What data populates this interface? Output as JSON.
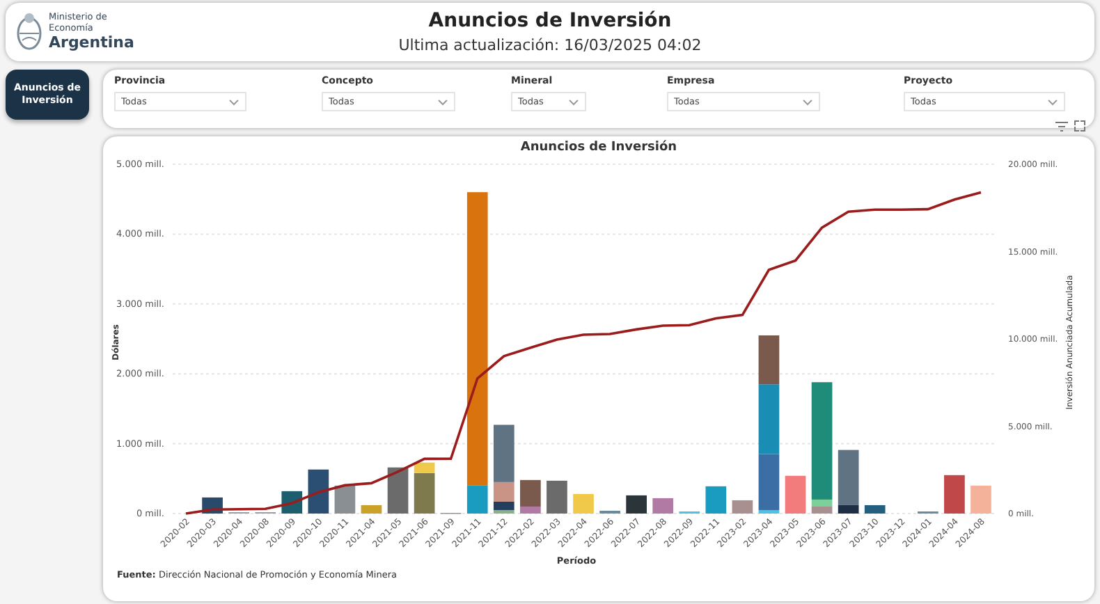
{
  "header": {
    "logo_small": "Ministerio de Economía",
    "logo_big": "Argentina",
    "title": "Anuncios de Inversión",
    "subtitle": "Ultima actualización: 16/03/2025 04:02"
  },
  "nav": [
    {
      "label": "Anuncios de Inversión",
      "selected": true
    }
  ],
  "filters": [
    {
      "label": "Provincia",
      "value": "Todas"
    },
    {
      "label": "Concepto",
      "value": "Todas"
    },
    {
      "label": "Mineral",
      "value": "Todas"
    },
    {
      "label": "Empresa",
      "value": "Todas"
    },
    {
      "label": "Proyecto",
      "value": "Todas"
    }
  ],
  "chart": {
    "title": "Anuncios de Inversión",
    "source": "**Fuente:** Dirección Nacional de Promoción y Economía Minera",
    "chart_data": {
      "type": "bar",
      "stacked": true,
      "grid": true,
      "xlabel": "Período",
      "ylabel": "Dólares",
      "categories": [
        "2020-02",
        "2020-03",
        "2020-04",
        "2020-08",
        "2020-09",
        "2020-10",
        "2020-11",
        "2021-04",
        "2021-05",
        "2021-06",
        "2021-09",
        "2021-11",
        "2021-12",
        "2022-02",
        "2022-03",
        "2022-04",
        "2022-06",
        "2022-07",
        "2022-08",
        "2022-09",
        "2022-11",
        "2023-02",
        "2023-04",
        "2023-05",
        "2023-06",
        "2023-07",
        "2023-10",
        "2023-12",
        "2024-01",
        "2024-04",
        "2024-08"
      ],
      "ylim": [
        0,
        5000
      ],
      "yticks": [
        {
          "value": 0,
          "label": "0 mill."
        },
        {
          "value": 1000,
          "label": "1.000 mill."
        },
        {
          "value": 2000,
          "label": "2.000 mill."
        },
        {
          "value": 3000,
          "label": "3.000 mill."
        },
        {
          "value": 4000,
          "label": "4.000 mill."
        },
        {
          "value": 5000,
          "label": "5.000 mill."
        }
      ],
      "y2lim": [
        0,
        20000
      ],
      "y2ticks": [
        {
          "value": 0,
          "label": "0 mill."
        },
        {
          "value": 5000,
          "label": "5.000 mill."
        },
        {
          "value": 10000,
          "label": "10.000 mill."
        },
        {
          "value": 15000,
          "label": "15.000 mill."
        },
        {
          "value": 20000,
          "label": "20.000 mill."
        }
      ],
      "series": [
        {
          "color": "#2a4a6b",
          "values": [
            null,
            230,
            null,
            null,
            null,
            null,
            null,
            null,
            null,
            null,
            null,
            null,
            null,
            null,
            null,
            null,
            null,
            null,
            null,
            null,
            null,
            null,
            null,
            null,
            null,
            null,
            null,
            null,
            null,
            null,
            null
          ]
        },
        {
          "color": "#9aa0a6",
          "values": [
            null,
            null,
            20,
            20,
            null,
            null,
            null,
            null,
            null,
            null,
            10,
            null,
            null,
            null,
            null,
            null,
            null,
            null,
            null,
            null,
            null,
            null,
            null,
            null,
            null,
            null,
            null,
            null,
            null,
            null,
            null
          ]
        },
        {
          "color": "#1d5e6e",
          "values": [
            null,
            null,
            null,
            null,
            320,
            null,
            null,
            null,
            null,
            null,
            null,
            null,
            null,
            null,
            null,
            null,
            null,
            null,
            null,
            null,
            null,
            null,
            null,
            null,
            null,
            null,
            null,
            null,
            null,
            null,
            null
          ]
        },
        {
          "color": "#2a4f73",
          "values": [
            null,
            null,
            null,
            null,
            null,
            630,
            null,
            null,
            null,
            null,
            null,
            null,
            null,
            null,
            null,
            null,
            null,
            null,
            null,
            null,
            null,
            null,
            null,
            null,
            null,
            null,
            null,
            null,
            null,
            null,
            null
          ]
        },
        {
          "color": "#8a8f94",
          "values": [
            null,
            null,
            null,
            null,
            null,
            null,
            400,
            null,
            null,
            null,
            null,
            null,
            null,
            null,
            null,
            null,
            null,
            null,
            null,
            null,
            null,
            null,
            null,
            null,
            null,
            null,
            null,
            null,
            null,
            null,
            null
          ]
        },
        {
          "color": "#c9a227",
          "values": [
            null,
            null,
            null,
            null,
            null,
            null,
            null,
            120,
            null,
            null,
            null,
            null,
            null,
            null,
            null,
            null,
            null,
            null,
            null,
            null,
            null,
            null,
            null,
            null,
            null,
            null,
            null,
            null,
            null,
            null,
            null
          ]
        },
        {
          "color": "#6b6b6b",
          "values": [
            null,
            null,
            null,
            null,
            null,
            null,
            null,
            null,
            660,
            null,
            null,
            null,
            null,
            null,
            470,
            null,
            null,
            null,
            null,
            null,
            null,
            null,
            null,
            null,
            null,
            null,
            null,
            null,
            null,
            null,
            null
          ]
        },
        {
          "color": "#7e7a4e",
          "values": [
            null,
            null,
            null,
            null,
            null,
            null,
            null,
            null,
            null,
            580,
            null,
            null,
            null,
            null,
            null,
            null,
            null,
            null,
            null,
            null,
            null,
            null,
            null,
            null,
            null,
            null,
            null,
            null,
            null,
            null,
            null
          ]
        },
        {
          "color": "#f0c94a",
          "values": [
            null,
            null,
            null,
            null,
            null,
            null,
            null,
            null,
            null,
            150,
            null,
            null,
            null,
            null,
            null,
            280,
            null,
            null,
            null,
            null,
            null,
            null,
            null,
            null,
            null,
            null,
            null,
            null,
            null,
            null,
            null
          ]
        },
        {
          "color": "#1a9bc0",
          "values": [
            null,
            null,
            null,
            null,
            null,
            null,
            null,
            null,
            null,
            null,
            null,
            400,
            null,
            null,
            null,
            null,
            null,
            null,
            null,
            null,
            390,
            null,
            null,
            null,
            null,
            null,
            null,
            null,
            null,
            null,
            null
          ]
        },
        {
          "color": "#d9730d",
          "values": [
            null,
            null,
            null,
            null,
            null,
            null,
            null,
            null,
            null,
            null,
            null,
            4200,
            null,
            null,
            null,
            null,
            null,
            null,
            null,
            null,
            null,
            null,
            null,
            null,
            null,
            null,
            null,
            null,
            null,
            null,
            null
          ]
        },
        {
          "color": "#8ab08a",
          "values": [
            null,
            null,
            null,
            null,
            null,
            null,
            null,
            null,
            null,
            null,
            null,
            null,
            50,
            null,
            null,
            null,
            null,
            null,
            null,
            null,
            null,
            null,
            null,
            null,
            null,
            null,
            null,
            null,
            null,
            null,
            null
          ]
        },
        {
          "color": "#243f5e",
          "values": [
            null,
            null,
            null,
            null,
            null,
            null,
            null,
            null,
            null,
            null,
            null,
            null,
            120,
            null,
            null,
            null,
            null,
            null,
            null,
            null,
            null,
            null,
            null,
            null,
            null,
            null,
            null,
            null,
            null,
            null,
            null
          ]
        },
        {
          "color": "#c99385",
          "values": [
            null,
            null,
            null,
            null,
            null,
            null,
            null,
            null,
            null,
            null,
            null,
            null,
            280,
            null,
            null,
            null,
            null,
            null,
            null,
            null,
            null,
            null,
            null,
            null,
            null,
            null,
            null,
            null,
            null,
            null,
            null
          ]
        },
        {
          "color": "#1d2e45",
          "values": [
            null,
            null,
            null,
            null,
            null,
            null,
            null,
            null,
            null,
            null,
            null,
            null,
            null,
            null,
            null,
            null,
            null,
            null,
            null,
            null,
            null,
            null,
            null,
            null,
            null,
            120,
            null,
            null,
            null,
            null,
            null
          ]
        },
        {
          "color": "#5f7382",
          "values": [
            null,
            null,
            null,
            null,
            null,
            null,
            null,
            null,
            null,
            null,
            null,
            null,
            820,
            null,
            null,
            null,
            null,
            null,
            null,
            null,
            null,
            null,
            null,
            null,
            null,
            790,
            null,
            null,
            null,
            null,
            null
          ]
        },
        {
          "color": "#b07aa5",
          "values": [
            null,
            null,
            null,
            null,
            null,
            null,
            null,
            null,
            null,
            null,
            null,
            null,
            null,
            100,
            null,
            null,
            null,
            null,
            220,
            null,
            null,
            null,
            null,
            null,
            null,
            null,
            null,
            null,
            null,
            null,
            null
          ]
        },
        {
          "color": "#4dc3e0",
          "values": [
            null,
            null,
            null,
            null,
            null,
            null,
            null,
            null,
            null,
            null,
            null,
            null,
            null,
            null,
            null,
            null,
            null,
            null,
            null,
            30,
            null,
            null,
            50,
            null,
            null,
            null,
            null,
            null,
            null,
            null,
            null
          ]
        },
        {
          "color": "#3a6ea5",
          "values": [
            null,
            null,
            null,
            null,
            null,
            null,
            null,
            null,
            null,
            null,
            null,
            null,
            null,
            null,
            null,
            null,
            null,
            null,
            null,
            null,
            null,
            null,
            800,
            null,
            null,
            null,
            null,
            null,
            null,
            null,
            null
          ]
        },
        {
          "color": "#1a8db5",
          "values": [
            null,
            null,
            null,
            null,
            null,
            null,
            null,
            null,
            null,
            null,
            null,
            null,
            null,
            null,
            null,
            null,
            null,
            null,
            null,
            null,
            null,
            null,
            1000,
            null,
            null,
            null,
            null,
            null,
            null,
            null,
            null
          ]
        },
        {
          "color": "#7a5a4c",
          "values": [
            null,
            null,
            null,
            null,
            null,
            null,
            null,
            null,
            null,
            null,
            null,
            null,
            null,
            380,
            null,
            null,
            null,
            null,
            null,
            null,
            null,
            null,
            700,
            null,
            null,
            null,
            null,
            null,
            null,
            null,
            null
          ]
        },
        {
          "color": "#6a8a9a",
          "values": [
            null,
            null,
            null,
            null,
            null,
            null,
            null,
            null,
            null,
            null,
            null,
            null,
            null,
            null,
            null,
            null,
            40,
            null,
            null,
            null,
            null,
            null,
            null,
            null,
            null,
            null,
            null,
            null,
            30,
            null,
            null
          ]
        },
        {
          "color": "#2b3438",
          "values": [
            null,
            null,
            null,
            null,
            null,
            null,
            null,
            null,
            null,
            null,
            null,
            null,
            null,
            null,
            null,
            null,
            null,
            260,
            null,
            null,
            null,
            null,
            null,
            null,
            null,
            null,
            null,
            null,
            null,
            null,
            null
          ]
        },
        {
          "color": "#a89090",
          "values": [
            null,
            null,
            null,
            null,
            null,
            null,
            null,
            null,
            null,
            null,
            null,
            null,
            null,
            null,
            null,
            null,
            null,
            null,
            null,
            null,
            null,
            190,
            null,
            null,
            100,
            null,
            null,
            null,
            null,
            null,
            null
          ]
        },
        {
          "color": "#f27c7c",
          "values": [
            null,
            null,
            null,
            null,
            null,
            null,
            null,
            null,
            null,
            null,
            null,
            null,
            null,
            null,
            null,
            null,
            null,
            null,
            null,
            null,
            null,
            null,
            null,
            540,
            null,
            null,
            null,
            null,
            null,
            null,
            null
          ]
        },
        {
          "color": "#7ed09a",
          "values": [
            null,
            null,
            null,
            null,
            null,
            null,
            null,
            null,
            null,
            null,
            null,
            null,
            null,
            null,
            null,
            null,
            null,
            null,
            null,
            null,
            null,
            null,
            null,
            null,
            100,
            null,
            null,
            null,
            null,
            null,
            null
          ]
        },
        {
          "color": "#1f8c7a",
          "values": [
            null,
            null,
            null,
            null,
            null,
            null,
            null,
            null,
            null,
            null,
            null,
            null,
            null,
            null,
            null,
            null,
            null,
            null,
            null,
            null,
            null,
            null,
            null,
            null,
            1680,
            null,
            null,
            null,
            null,
            null,
            null
          ]
        },
        {
          "color": "#255f80",
          "values": [
            null,
            null,
            null,
            null,
            null,
            null,
            null,
            null,
            null,
            null,
            null,
            null,
            null,
            null,
            null,
            null,
            null,
            null,
            null,
            null,
            null,
            null,
            null,
            null,
            null,
            null,
            120,
            null,
            null,
            null,
            null
          ]
        },
        {
          "color": "#c04848",
          "values": [
            null,
            null,
            null,
            null,
            null,
            null,
            null,
            null,
            null,
            null,
            null,
            null,
            null,
            null,
            null,
            null,
            null,
            null,
            null,
            null,
            null,
            null,
            null,
            null,
            null,
            null,
            null,
            null,
            null,
            550,
            null
          ]
        },
        {
          "color": "#f4b29a",
          "values": [
            null,
            null,
            null,
            null,
            null,
            null,
            null,
            null,
            null,
            null,
            null,
            null,
            null,
            null,
            null,
            null,
            null,
            null,
            null,
            null,
            null,
            null,
            null,
            null,
            null,
            null,
            null,
            null,
            null,
            null,
            400
          ]
        },
        {
          "name": "Inversión Anunciada Acumulada",
          "color": "#9b1c1c",
          "type": "line",
          "axis": "y2",
          "values": [
            0,
            230,
            250,
            270,
            590,
            1220,
            1620,
            1740,
            2400,
            3130,
            3140,
            7740,
            9010,
            9490,
            9960,
            10240,
            10280,
            10540,
            10760,
            10790,
            11180,
            11370,
            13950,
            14490,
            16370,
            17280,
            17400,
            17400,
            17430,
            17980,
            18380
          ]
        }
      ]
    }
  }
}
